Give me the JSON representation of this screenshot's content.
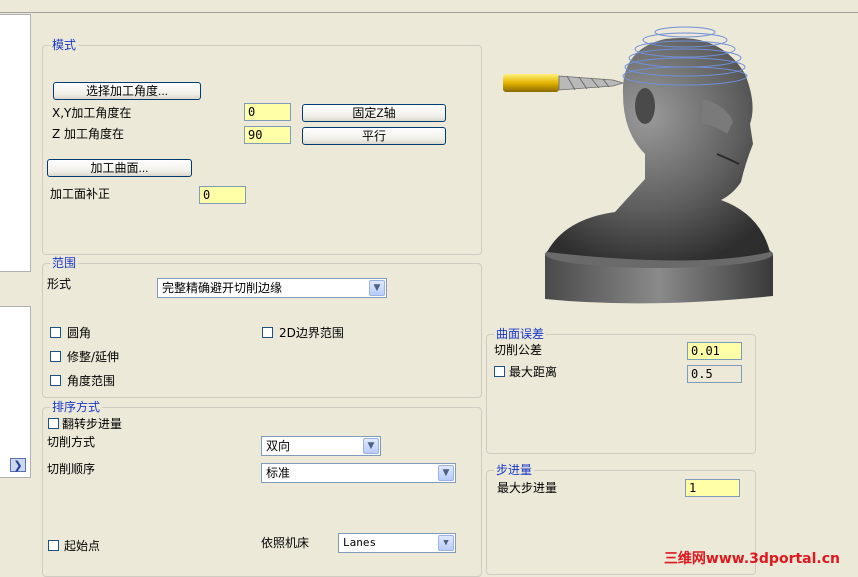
{
  "mode": {
    "title": "模式",
    "select_angle_button": "选择加工角度...",
    "xy_angle_label": "X,Y加工角度在",
    "xy_angle_value": "0",
    "fix_z_button": "固定Z轴",
    "z_angle_label": "Z 加工角度在",
    "z_angle_value": "90",
    "parallel_button": "平行",
    "surface_button": "加工曲面...",
    "surface_offset_label": "加工面补正",
    "surface_offset_value": "0"
  },
  "range": {
    "title": "范围",
    "form_label": "形式",
    "form_value": "完整精确避开切削边缘",
    "fillet_label": "圆角",
    "boundary2d_label": "2D边界范围",
    "trim_label": "修整/延伸",
    "angle_range_label": "角度范围"
  },
  "order": {
    "title": "排序方式",
    "reverse_step_label": "翻转步进量",
    "cut_method_label": "切削方式",
    "cut_method_value": "双向",
    "cut_order_label": "切削顺序",
    "cut_order_value": "标准",
    "start_point_label": "起始点",
    "machine_label": "依照机床",
    "machine_value": "Lanes"
  },
  "surface_error": {
    "title": "曲面误差",
    "tolerance_label": "切削公差",
    "tolerance_value": "0.01",
    "max_distance_label": "最大距离",
    "max_distance_value": "0.5"
  },
  "stepover": {
    "title": "步进量",
    "max_stepover_label": "最大步进量",
    "max_stepover_value": "1"
  },
  "watermark": "三维网www.3dportal.cn",
  "icons": {
    "expander": "chevron-right-icon",
    "dropdown": "chevron-down-icon"
  }
}
